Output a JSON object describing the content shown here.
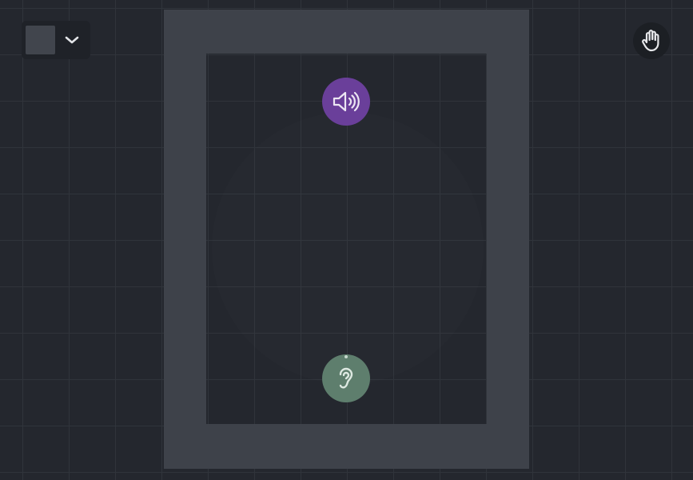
{
  "toolbar": {
    "color_picker": {
      "swatch_color": "#41454d",
      "icon": "chevron-down-icon"
    },
    "hand_tool": {
      "icon": "hand-icon"
    }
  },
  "canvas": {
    "background": "#24272e",
    "grid_color": "#30343b",
    "room": {
      "wall_color": "#3e424a",
      "floor_color": "#24272e"
    },
    "nodes": [
      {
        "kind": "speaker",
        "icon": "speaker-volume-icon",
        "color": "#6a3f9a"
      },
      {
        "kind": "listener",
        "icon": "ear-icon",
        "color": "#5e7e6d"
      }
    ]
  }
}
